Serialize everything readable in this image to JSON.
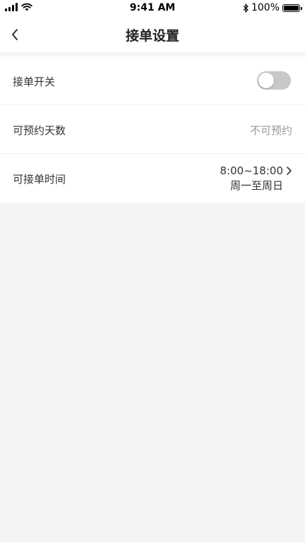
{
  "status_bar": {
    "time": "9:41 AM",
    "battery": "100%",
    "battery_level": 1.0
  },
  "nav": {
    "title": "接单设置",
    "back_icon": "chevron-left-icon"
  },
  "settings": {
    "order_switch": {
      "label": "接单开关",
      "enabled": false
    },
    "booking_days": {
      "label": "可预约天数",
      "value": "不可预约"
    },
    "order_time": {
      "label": "可接单时间",
      "time_range": "8:00~18:00",
      "days": "周一至周日",
      "arrow_icon": "chevron-right-icon"
    }
  },
  "colors": {
    "background": "#f4f4f4",
    "toggle_off": "#c8c8c8",
    "muted_text": "#999999"
  }
}
